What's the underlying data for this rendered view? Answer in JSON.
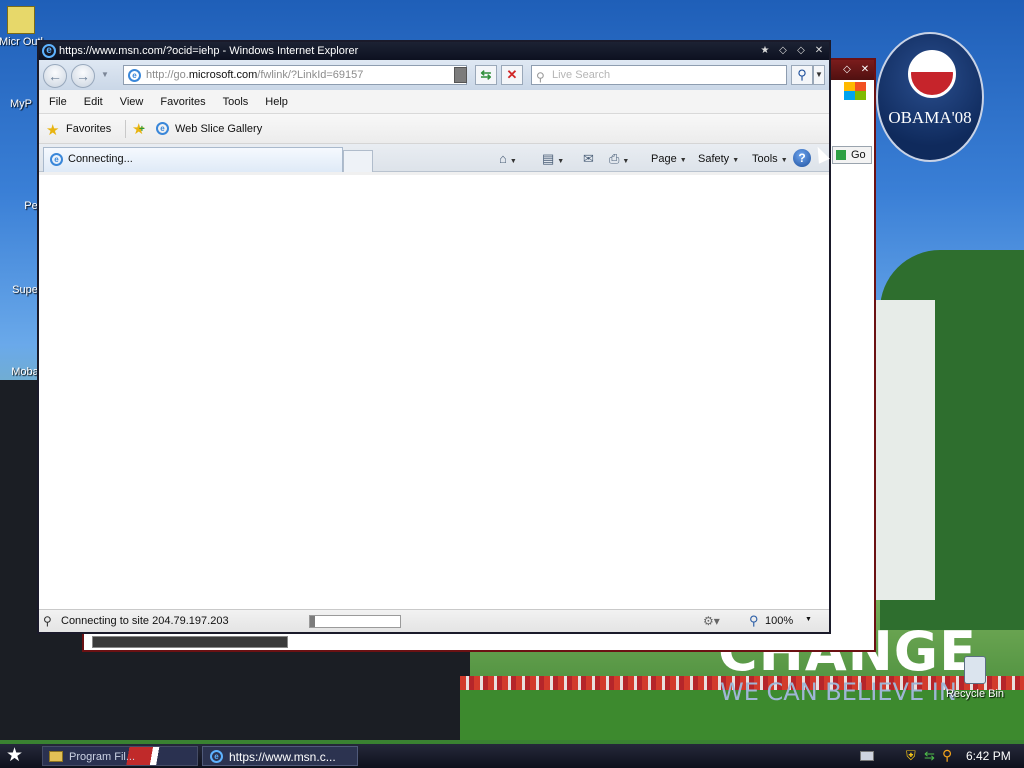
{
  "wallpaper": {
    "badge_text": "OBAMA'08",
    "slogan_main": "CHANGE",
    "slogan_sub": "WE CAN BELIEVE IN"
  },
  "desktop_icons": [
    {
      "label": "Micr Outl"
    },
    {
      "label": "MyP"
    },
    {
      "label": "Pe"
    },
    {
      "label": "Supe"
    },
    {
      "label": "Moba"
    }
  ],
  "recycle_bin": {
    "label": "Recycle Bin"
  },
  "background_window": {
    "go_label": "Go"
  },
  "ie": {
    "title": "https://www.msn.com/?ocid=iehp - Windows Internet Explorer",
    "address": {
      "prefix": "http://go.",
      "domain": "microsoft.com",
      "suffix": "/fwlink/?LinkId=69157"
    },
    "search_placeholder": "Live Search",
    "menu": [
      "File",
      "Edit",
      "View",
      "Favorites",
      "Tools",
      "Help"
    ],
    "favorites_label": "Favorites",
    "web_slice_label": "Web Slice Gallery",
    "tab_title": "Connecting...",
    "commands": {
      "page": "Page",
      "safety": "Safety",
      "tools": "Tools"
    },
    "status": {
      "text": "Connecting to site 204.79.197.203",
      "progress": 0.05,
      "zoom": "100%"
    }
  },
  "taskbar": {
    "item1_label": "Program Fil...",
    "item2_label": "https://www.msn.c...",
    "clock": "6:42 PM"
  }
}
